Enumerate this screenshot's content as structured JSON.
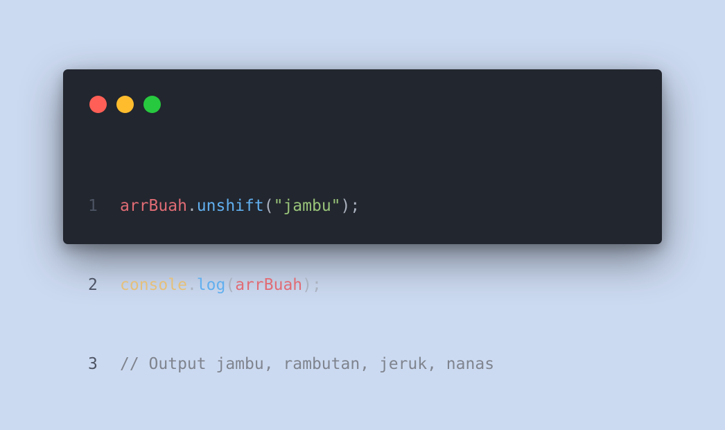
{
  "colors": {
    "background": "#ccdaf1",
    "editor_background": "#22262e",
    "close_button": "#ff5f56",
    "minimize_button": "#ffbd2e",
    "maximize_button": "#27c93f",
    "line_number": "#4c5363",
    "variable": "#e06c75",
    "function": "#61afef",
    "object": "#e5c07b",
    "string": "#98c379",
    "punctuation": "#abb2bf",
    "comment": "#7f848e"
  },
  "window_controls": [
    {
      "name": "close",
      "icon": "red-dot-icon"
    },
    {
      "name": "minimize",
      "icon": "yellow-dot-icon"
    },
    {
      "name": "maximize",
      "icon": "green-dot-icon"
    }
  ],
  "code": {
    "lines": [
      {
        "number": "1",
        "tokens": [
          {
            "text": "arrBuah",
            "kind": "variable"
          },
          {
            "text": ".",
            "kind": "punctuation"
          },
          {
            "text": "unshift",
            "kind": "function"
          },
          {
            "text": "(",
            "kind": "punctuation"
          },
          {
            "text": "\"jambu\"",
            "kind": "string"
          },
          {
            "text": ");",
            "kind": "punctuation"
          }
        ]
      },
      {
        "number": "2",
        "tokens": [
          {
            "text": "console",
            "kind": "object"
          },
          {
            "text": ".",
            "kind": "punctuation"
          },
          {
            "text": "log",
            "kind": "function"
          },
          {
            "text": "(",
            "kind": "punctuation"
          },
          {
            "text": "arrBuah",
            "kind": "variable"
          },
          {
            "text": ");",
            "kind": "punctuation"
          }
        ]
      },
      {
        "number": "3",
        "tokens": [
          {
            "text": "// Output jambu, rambutan, jeruk, nanas",
            "kind": "comment"
          }
        ]
      }
    ]
  }
}
